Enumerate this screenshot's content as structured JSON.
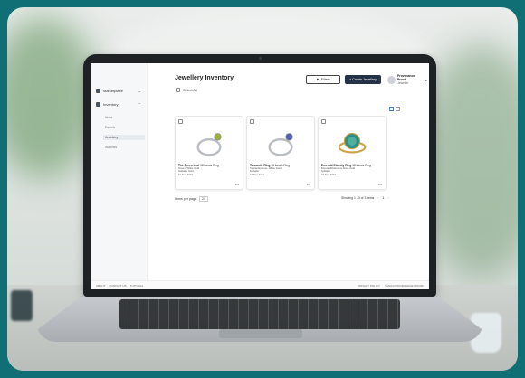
{
  "app": {
    "title": "Jewellery Inventory",
    "select_all_label": "Select All"
  },
  "sidebar": {
    "items": [
      {
        "label": "Marketplace"
      },
      {
        "label": "Inventory"
      }
    ],
    "sub_items": [
      {
        "label": "Items"
      },
      {
        "label": "Parcels"
      },
      {
        "label": "Jewellery"
      },
      {
        "label": "Watches"
      }
    ]
  },
  "header": {
    "filter_label": "Filters",
    "create_label": "+ Create Jewellery",
    "user_name": "Provenance Proof",
    "user_role": "Jeweller"
  },
  "cards": [
    {
      "title": "The Green Leaf",
      "title_rest": " 18 karats Ring",
      "meta": [
        "Green, White Gold",
        "Solitaire Gold",
        "10 Nov 2024"
      ],
      "more": "•••"
    },
    {
      "title": "Tanzanite Ring",
      "title_rest": " 18 karats Ring",
      "meta": [
        "Tanzanite/Amer. White Gold",
        "Solitaire",
        "10 Nov 2024"
      ],
      "more": "•••"
    },
    {
      "title": "Emerald Eternity Ring",
      "title_rest": " 18 karats Ring",
      "meta": [
        "Emerald/Diamond, Rose Gold",
        "Solitaire",
        "10 Nov 2024"
      ],
      "more": "•••"
    }
  ],
  "pagination": {
    "per_page_label": "Items per page",
    "per_page_value": "24",
    "showing": "Showing 1 - 3 of 3 items",
    "prev": "‹",
    "page": "1",
    "next": "›"
  },
  "footer": {
    "links": [
      "ABOUT",
      "CONTACT US",
      "TUTORIAL"
    ],
    "right": [
      "PRIVACY POLICY",
      "© 2024 PROVENANCE PROOF"
    ]
  },
  "colors": {
    "primary_button": "#243248",
    "accent": "#2a62c9",
    "frame": "#0f6f74"
  }
}
